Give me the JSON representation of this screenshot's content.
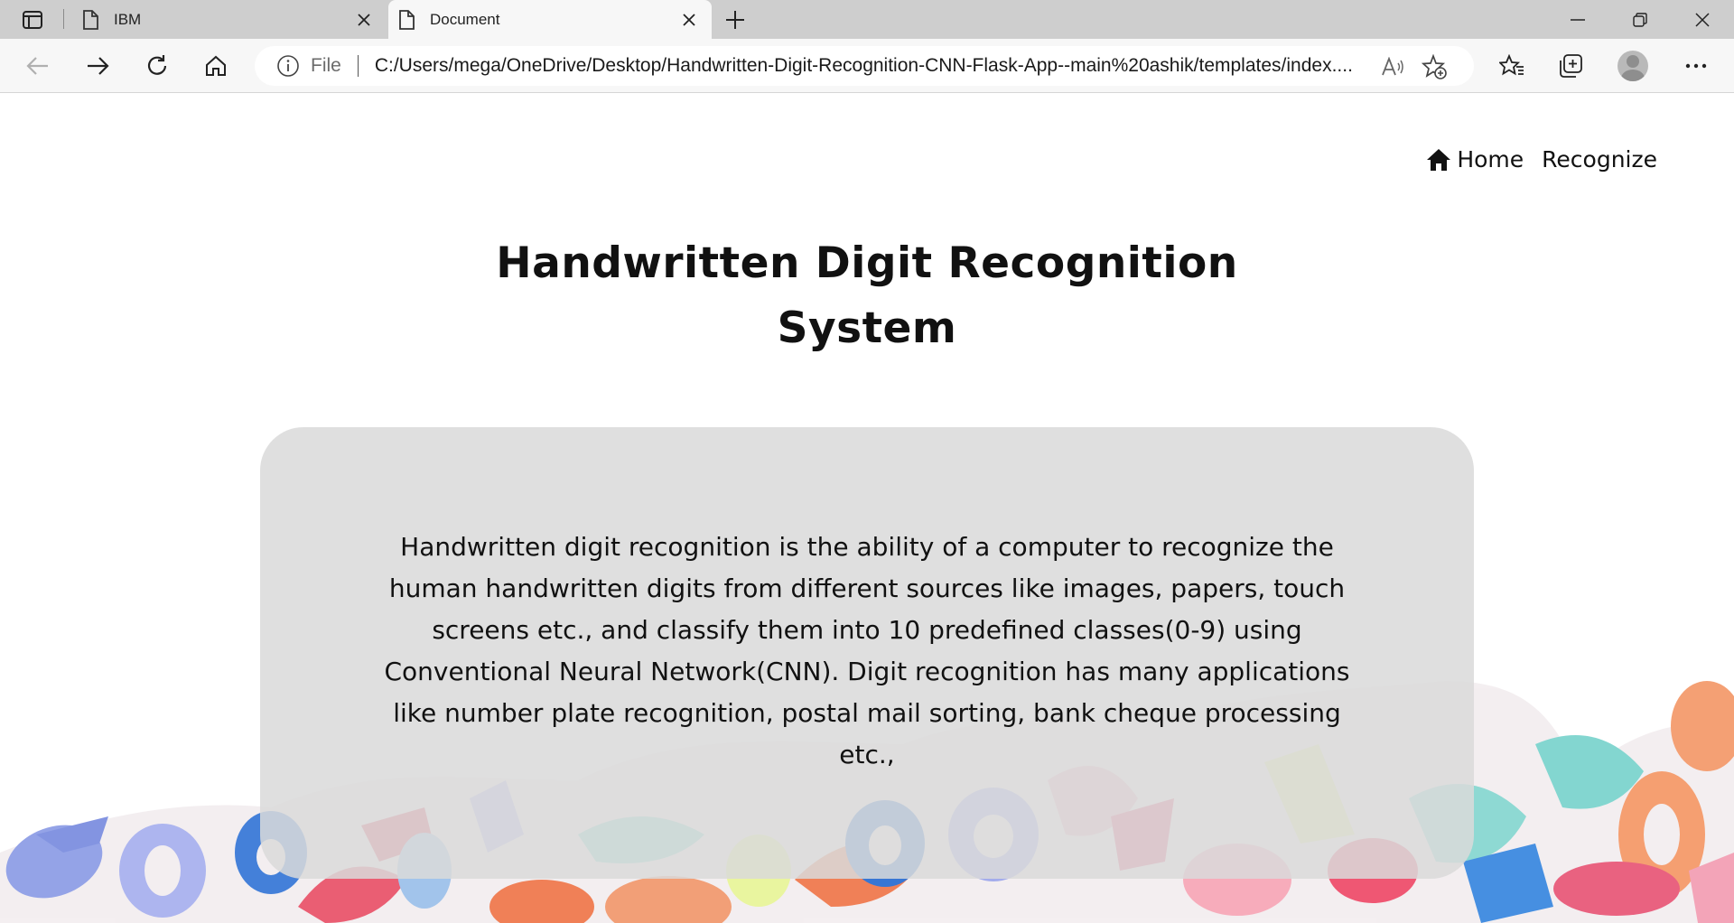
{
  "browser": {
    "tabs": [
      {
        "title": "IBM",
        "active": false
      },
      {
        "title": "Document",
        "active": true
      }
    ],
    "address": {
      "scheme_label": "File",
      "url": "C:/Users/mega/OneDrive/Desktop/Handwritten-Digit-Recognition-CNN-Flask-App--main%20ashik/templates/index...."
    }
  },
  "site": {
    "nav": {
      "home_label": "Home",
      "recognize_label": "Recognize"
    },
    "title_line1": "Handwritten Digit Recognition",
    "title_line2": "System",
    "description": "Handwritten digit recognition is the ability of a computer to recognize the human handwritten digits from different sources like images, papers, touch screens etc., and classify them into 10 predefined classes(0-9) using Conventional Neural Network(CNN). Digit recognition has many applications like number plate recognition, postal mail sorting, bank cheque processing etc.,"
  },
  "colors": {
    "tabbar_bg": "#cecece",
    "toolbar_bg": "#f7f7f7",
    "card_bg": "#dadada",
    "text": "#111111"
  },
  "icons": [
    "tab-actions-icon",
    "page-icon",
    "close-icon",
    "plus-icon",
    "minimize-icon",
    "restore-icon",
    "window-close-icon",
    "back-icon",
    "forward-icon",
    "refresh-icon",
    "home-icon",
    "info-icon",
    "read-aloud-icon",
    "add-favorite-icon",
    "favorites-icon",
    "collections-icon",
    "profile-avatar",
    "more-icon"
  ]
}
